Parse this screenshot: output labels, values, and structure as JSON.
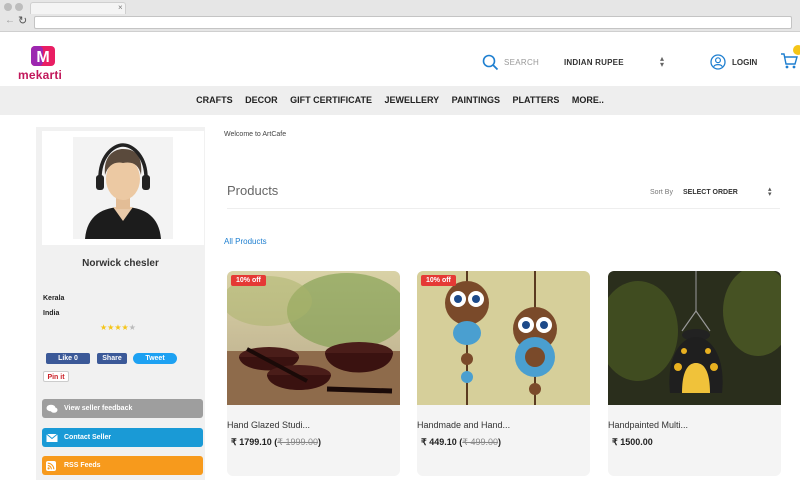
{
  "brand": {
    "name": "mekarti",
    "logo_letter": "M"
  },
  "header": {
    "search_label": "SEARCH",
    "currency": "INDIAN RUPEE",
    "login_label": "LOGIN"
  },
  "nav": {
    "items": [
      {
        "label": "CRAFTS"
      },
      {
        "label": "DECOR"
      },
      {
        "label": "GIFT CERTIFICATE"
      },
      {
        "label": "JEWELLERY"
      },
      {
        "label": "PAINTINGS"
      },
      {
        "label": "PLATTERS"
      },
      {
        "label": "MORE.."
      }
    ]
  },
  "seller": {
    "name": "Norwick chesler",
    "state": "Kerala",
    "country": "India",
    "rating": 4,
    "rating_max": 5
  },
  "social": {
    "like_label": "Like 0",
    "share_label": "Share",
    "tweet_label": "Tweet",
    "pin_label": "Pin it"
  },
  "sidebar_buttons": {
    "feedback_label": "View seller feedback",
    "contact_label": "Contact Seller",
    "rss_label": "RSS Feeds"
  },
  "main": {
    "welcome": "Welcome to ArtCafe",
    "products_title": "Products",
    "sort_label": "Sort By",
    "sort_value": "SELECT ORDER",
    "all_products_link": "All Products"
  },
  "products": [
    {
      "name": "Hand Glazed Studi...",
      "price": "₹ 1799.10",
      "old_price": "₹ 1999.00",
      "badge": "10% off"
    },
    {
      "name": "Handmade and Hand...",
      "price": "₹ 449.10",
      "old_price": "₹ 499.00",
      "badge": "10% off"
    },
    {
      "name": "Handpainted Multi...",
      "price": "₹ 1500.00",
      "old_price": "",
      "badge": ""
    }
  ],
  "colors": {
    "brand_pink": "#c2185b",
    "link_blue": "#1e7fd0",
    "badge_red": "#e53935",
    "contact_blue": "#1a9ad6",
    "rss_orange": "#f79a1c",
    "feedback_gray": "#9e9e9e",
    "facebook": "#3b5998",
    "twitter": "#1da1f2",
    "star": "#f5c518"
  },
  "icons": {
    "search": "search-icon",
    "user": "user-icon",
    "cart": "cart-icon",
    "feedback": "chat-bubbles-icon",
    "contact": "envelope-icon",
    "rss": "rss-icon"
  }
}
